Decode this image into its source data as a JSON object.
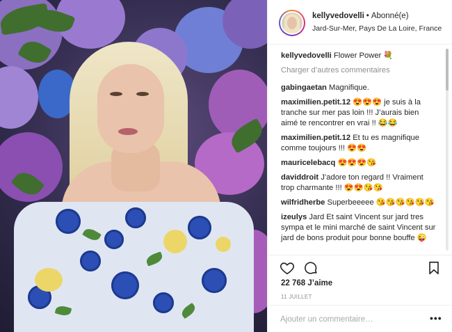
{
  "post": {
    "username": "kellyvedovelli",
    "separator": "•",
    "follow_status": "Abonné(e)",
    "location": "Jard-Sur-Mer, Pays De La Loire, France",
    "caption": {
      "user": "kellyvedovelli",
      "text": "Flower Power 💐"
    },
    "load_more_label": "Charger d’autres commentaires",
    "comments": [
      {
        "user": "gabingaetan",
        "text": "Magnifique."
      },
      {
        "user": "maximilien.petit.12",
        "text": "😍😍😍 je suis à la tranche sur mer pas loin !!! J’aurais bien aimé te rencontrer en vrai !! 😂😂"
      },
      {
        "user": "maximilien.petit.12",
        "text": "Et tu es magnifique comme toujours !!! 😍😍"
      },
      {
        "user": "mauricelebacq",
        "text": "😍😍😍😘"
      },
      {
        "user": "daviddroit",
        "text": "J’adore ton regard !! Vraiment trop charmante !!! 😍😍😘😘"
      },
      {
        "user": "wilfridherbe",
        "text": "Superbeeeee 😘😘😘😘😘😘"
      },
      {
        "user": "izeulys",
        "text": "Jard Et saint Vincent sur jard tres sympa et le mini marché de saint Vincent sur jard de bons produit pour bonne bouffe 😜"
      }
    ],
    "likes": "22 768 J’aime",
    "date": "11 JUILLET",
    "comment_placeholder": "Ajouter un commentaire…",
    "more_options_label": "•••"
  },
  "icons": {
    "like": "heart-icon",
    "comment": "comment-bubble-icon",
    "save": "bookmark-icon"
  },
  "colors": {
    "text": "#262626",
    "muted": "#8e8e8e",
    "border": "#efefef"
  }
}
